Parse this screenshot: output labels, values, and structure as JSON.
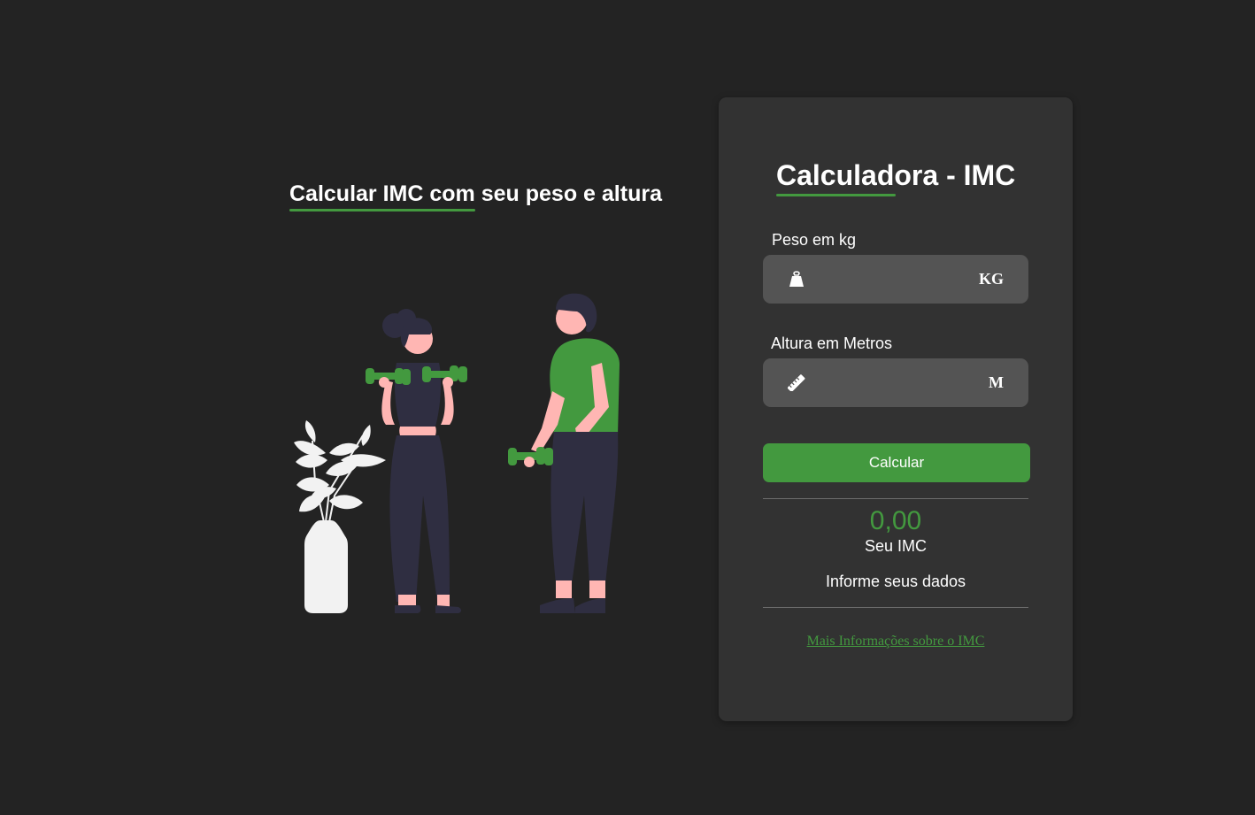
{
  "hero": {
    "title": "Calcular IMC com seu peso e altura"
  },
  "card": {
    "title": "Calculadora - IMC",
    "weight": {
      "label": "Peso em kg",
      "value": "",
      "placeholder": "",
      "unit": "KG",
      "icon": "weight-icon"
    },
    "height": {
      "label": "Altura em Metros",
      "value": "",
      "placeholder": "",
      "unit": "M",
      "icon": "ruler-icon"
    },
    "button_label": "Calcular",
    "result": {
      "value": "0,00",
      "label": "Seu IMC",
      "message": "Informe seus dados"
    },
    "more_link": "Mais Informações sobre o IMC"
  },
  "colors": {
    "background": "#232323",
    "card": "#323232",
    "field": "#545454",
    "accent": "#43993f",
    "skin": "#ffb6b3",
    "dark_clothes": "#2f2e41",
    "plant": "#f2f2f2"
  }
}
